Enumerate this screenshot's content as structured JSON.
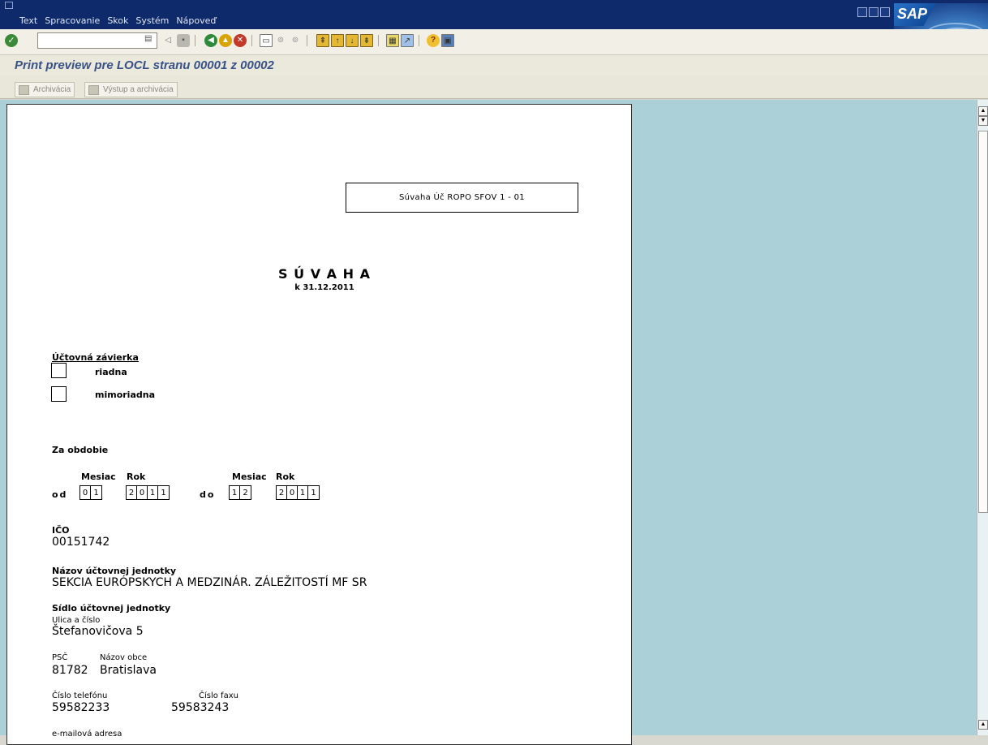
{
  "menu": {
    "items": [
      {
        "label": "Text"
      },
      {
        "label": "Spracovanie"
      },
      {
        "label": "Skok"
      },
      {
        "label": "Systém"
      },
      {
        "label": "Nápoveď"
      }
    ],
    "logo_text": "SAP"
  },
  "toolbar": {
    "command_value": "",
    "icons": [
      "enter-icon",
      "save-icon",
      "back-icon",
      "exit-icon",
      "cancel-icon",
      "print-icon",
      "find-icon",
      "find-next-icon",
      "first-page-icon",
      "previous-page-icon",
      "next-page-icon",
      "last-page-icon",
      "create-session-icon",
      "shortcut-icon",
      "help-icon",
      "layout-icon"
    ]
  },
  "title": "Print preview pre LOCL stranu 00001 z 00002",
  "app_toolbar": {
    "archive_label": "Archivácia",
    "output_archive_label": "Výstup a archivácia"
  },
  "document": {
    "form_box": "Súvaha Úč ROPO SFOV 1 - 01",
    "heading": "S Ú V A H A",
    "date": "k 31.12.2011",
    "closing_label": "Účtovná závierka",
    "closing_options": [
      "riadna",
      "mimoriadna"
    ],
    "period_label": "Za obdobie",
    "month_label": "Mesiac",
    "year_label": "Rok",
    "from_label": "od",
    "to_label": "do",
    "from_month": [
      "0",
      "1"
    ],
    "from_year": [
      "2",
      "0",
      "1",
      "1"
    ],
    "to_month": [
      "1",
      "2"
    ],
    "to_year": [
      "2",
      "0",
      "1",
      "1"
    ],
    "ico_label": "IČO",
    "ico_value": "00151742",
    "name_label": "Názov účtovnej jednotky",
    "name_value": "SEKCIA EURÓPSKYCH A MEDZINÁR. ZÁLEŽITOSTÍ MF SR",
    "seat_label": "Sídlo účtovnej jednotky",
    "street_label": "Ulica a číslo",
    "street_value": "Štefanovičova 5",
    "psc_label": "PSČ",
    "psc_value": "81782",
    "city_label": "Názov obce",
    "city_value": "Bratislava",
    "phone_label": "Číslo telefónu",
    "phone_value": "59582233",
    "fax_label": "Číslo faxu",
    "fax_value": "59583243",
    "email_label": "e-mailová adresa"
  }
}
